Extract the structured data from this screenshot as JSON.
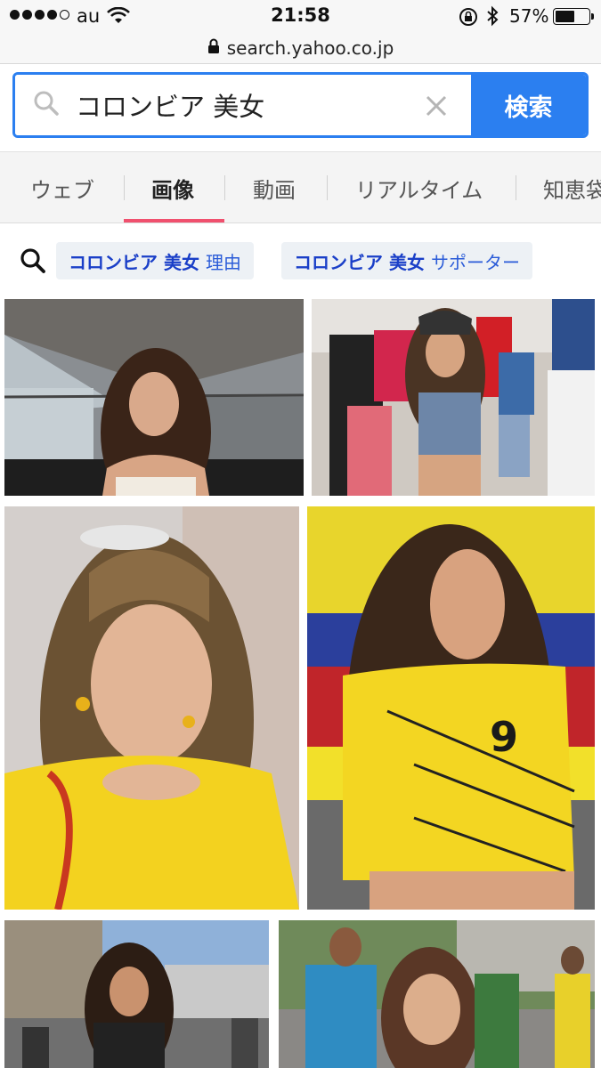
{
  "status_bar": {
    "carrier": "au",
    "time": "21:58",
    "battery_percent": "57%",
    "battery_level": 0.57
  },
  "url_bar": {
    "domain": "search.yahoo.co.jp"
  },
  "search": {
    "query": "コロンビア 美女",
    "button_label": "検索"
  },
  "tabs": [
    {
      "label": "ウェブ",
      "active": false
    },
    {
      "label": "画像",
      "active": true
    },
    {
      "label": "動画",
      "active": false
    },
    {
      "label": "リアルタイム",
      "active": false
    },
    {
      "label": "知恵袋",
      "active": false
    }
  ],
  "related": [
    {
      "strong": "コロンビア 美女",
      "weak": "理由"
    },
    {
      "strong": "コロンビア 美女",
      "weak": "サポーター"
    }
  ],
  "icons": {
    "search": "search-icon",
    "clear": "close-icon",
    "lock": "lock-icon",
    "wifi": "wifi-icon",
    "bluetooth": "bluetooth-icon",
    "orientation_lock": "orientation-lock-icon"
  },
  "colors": {
    "accent": "#2b7ff0",
    "tab_underline": "#f0506e",
    "chip_bg": "#edf1f5",
    "chip_text": "#1a3fc8"
  }
}
